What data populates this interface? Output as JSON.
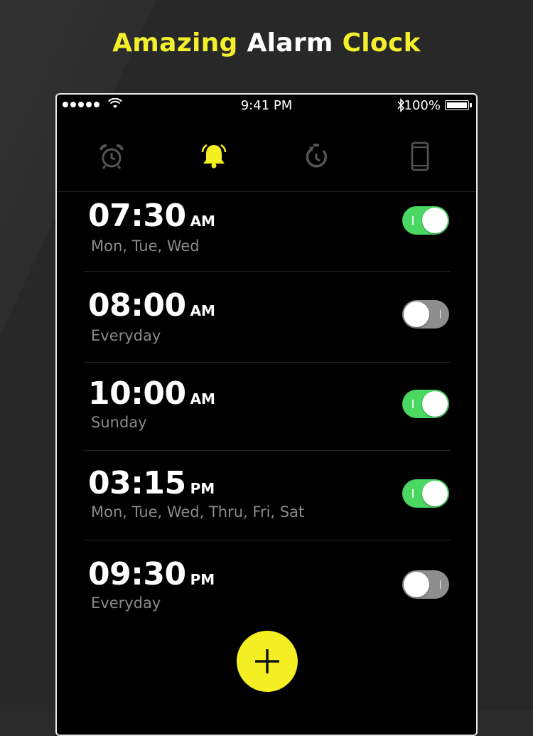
{
  "headline": {
    "part1": "Amazing",
    "part2": "Alarm",
    "part3": "Clock"
  },
  "status_bar": {
    "time": "9:41 PM",
    "battery": "100%"
  },
  "tabs": [
    {
      "name": "alarm-clock-icon",
      "active": false
    },
    {
      "name": "bell-icon",
      "active": true
    },
    {
      "name": "timer-icon",
      "active": false
    },
    {
      "name": "phone-icon",
      "active": false
    }
  ],
  "alarms": [
    {
      "time": "07:30",
      "period": "AM",
      "days": "Mon, Tue, Wed",
      "enabled": true
    },
    {
      "time": "08:00",
      "period": "AM",
      "days": "Everyday",
      "enabled": false
    },
    {
      "time": "10:00",
      "period": "AM",
      "days": "Sunday",
      "enabled": true
    },
    {
      "time": "03:15",
      "period": "PM",
      "days": "Mon, Tue, Wed, Thru, Fri, Sat",
      "enabled": true
    },
    {
      "time": "09:30",
      "period": "PM",
      "days": "Everyday",
      "enabled": false
    }
  ],
  "add_button": {
    "icon": "plus-icon"
  },
  "colors": {
    "accent": "#f3ef22",
    "toggle_on": "#4bd862",
    "toggle_off": "#8e8e8e",
    "background": "#2b2b2b"
  }
}
